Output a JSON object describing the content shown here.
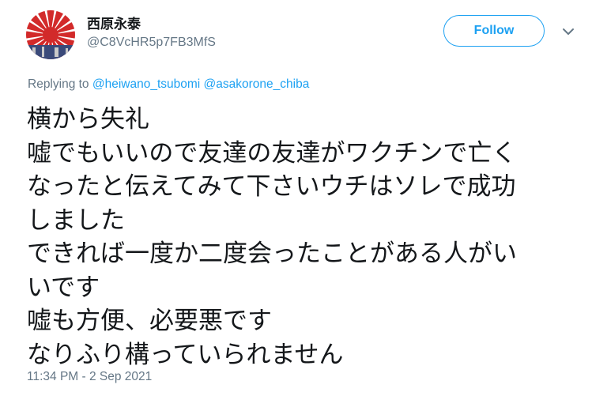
{
  "author": {
    "display_name": "西原永泰",
    "handle": "@C8VcHR5p7FB3MfS",
    "avatar_icon": "rising-sun-flag-avatar"
  },
  "follow_button": {
    "label": "Follow"
  },
  "menu_icon": "chevron-down-icon",
  "reply_context": {
    "prefix": "Replying to ",
    "mentions": [
      "@heiwano_tsubomi",
      "@asakorone_chiba"
    ]
  },
  "tweet": {
    "lines": [
      "横から失礼",
      "嘘でもいいので友達の友達がワクチンで亡く",
      "なったと伝えてみて下さいウチはソレで成功",
      "しました",
      "できれば一度か二度会ったことがある人がい",
      "いです",
      "嘘も方便、必要悪です",
      "なりふり構っていられません"
    ]
  },
  "timestamp": "11:34 PM - 2 Sep 2021",
  "colors": {
    "accent": "#1da1f2",
    "secondary_text": "#657786",
    "primary_text": "#14171a"
  }
}
